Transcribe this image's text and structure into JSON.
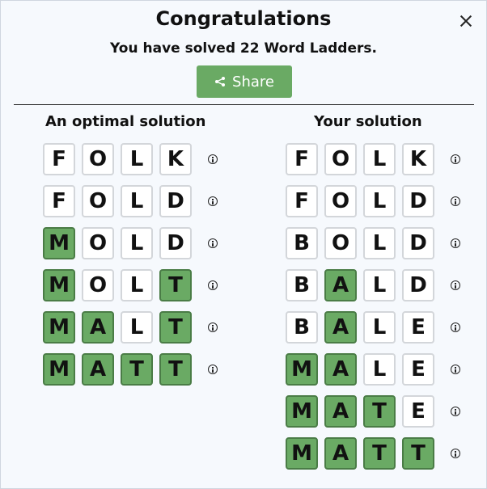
{
  "dialog": {
    "title": "Congratulations",
    "subtitle": "You have solved 22 Word Ladders.",
    "share_label": "Share",
    "close_icon": "close-icon",
    "share_icon": "share-icon"
  },
  "optimal": {
    "heading": "An optimal solution",
    "rows": [
      {
        "letters": [
          "F",
          "O",
          "L",
          "K"
        ],
        "green": [
          false,
          false,
          false,
          false
        ]
      },
      {
        "letters": [
          "F",
          "O",
          "L",
          "D"
        ],
        "green": [
          false,
          false,
          false,
          false
        ]
      },
      {
        "letters": [
          "M",
          "O",
          "L",
          "D"
        ],
        "green": [
          true,
          false,
          false,
          false
        ]
      },
      {
        "letters": [
          "M",
          "O",
          "L",
          "T"
        ],
        "green": [
          true,
          false,
          false,
          true
        ]
      },
      {
        "letters": [
          "M",
          "A",
          "L",
          "T"
        ],
        "green": [
          true,
          true,
          false,
          true
        ]
      },
      {
        "letters": [
          "M",
          "A",
          "T",
          "T"
        ],
        "green": [
          true,
          true,
          true,
          true
        ]
      }
    ]
  },
  "yours": {
    "heading": "Your solution",
    "rows": [
      {
        "letters": [
          "F",
          "O",
          "L",
          "K"
        ],
        "green": [
          false,
          false,
          false,
          false
        ]
      },
      {
        "letters": [
          "F",
          "O",
          "L",
          "D"
        ],
        "green": [
          false,
          false,
          false,
          false
        ]
      },
      {
        "letters": [
          "B",
          "O",
          "L",
          "D"
        ],
        "green": [
          false,
          false,
          false,
          false
        ]
      },
      {
        "letters": [
          "B",
          "A",
          "L",
          "D"
        ],
        "green": [
          false,
          true,
          false,
          false
        ]
      },
      {
        "letters": [
          "B",
          "A",
          "L",
          "E"
        ],
        "green": [
          false,
          true,
          false,
          false
        ]
      },
      {
        "letters": [
          "M",
          "A",
          "L",
          "E"
        ],
        "green": [
          true,
          true,
          false,
          false
        ]
      },
      {
        "letters": [
          "M",
          "A",
          "T",
          "E"
        ],
        "green": [
          true,
          true,
          true,
          false
        ]
      },
      {
        "letters": [
          "M",
          "A",
          "T",
          "T"
        ],
        "green": [
          true,
          true,
          true,
          true
        ]
      }
    ]
  }
}
